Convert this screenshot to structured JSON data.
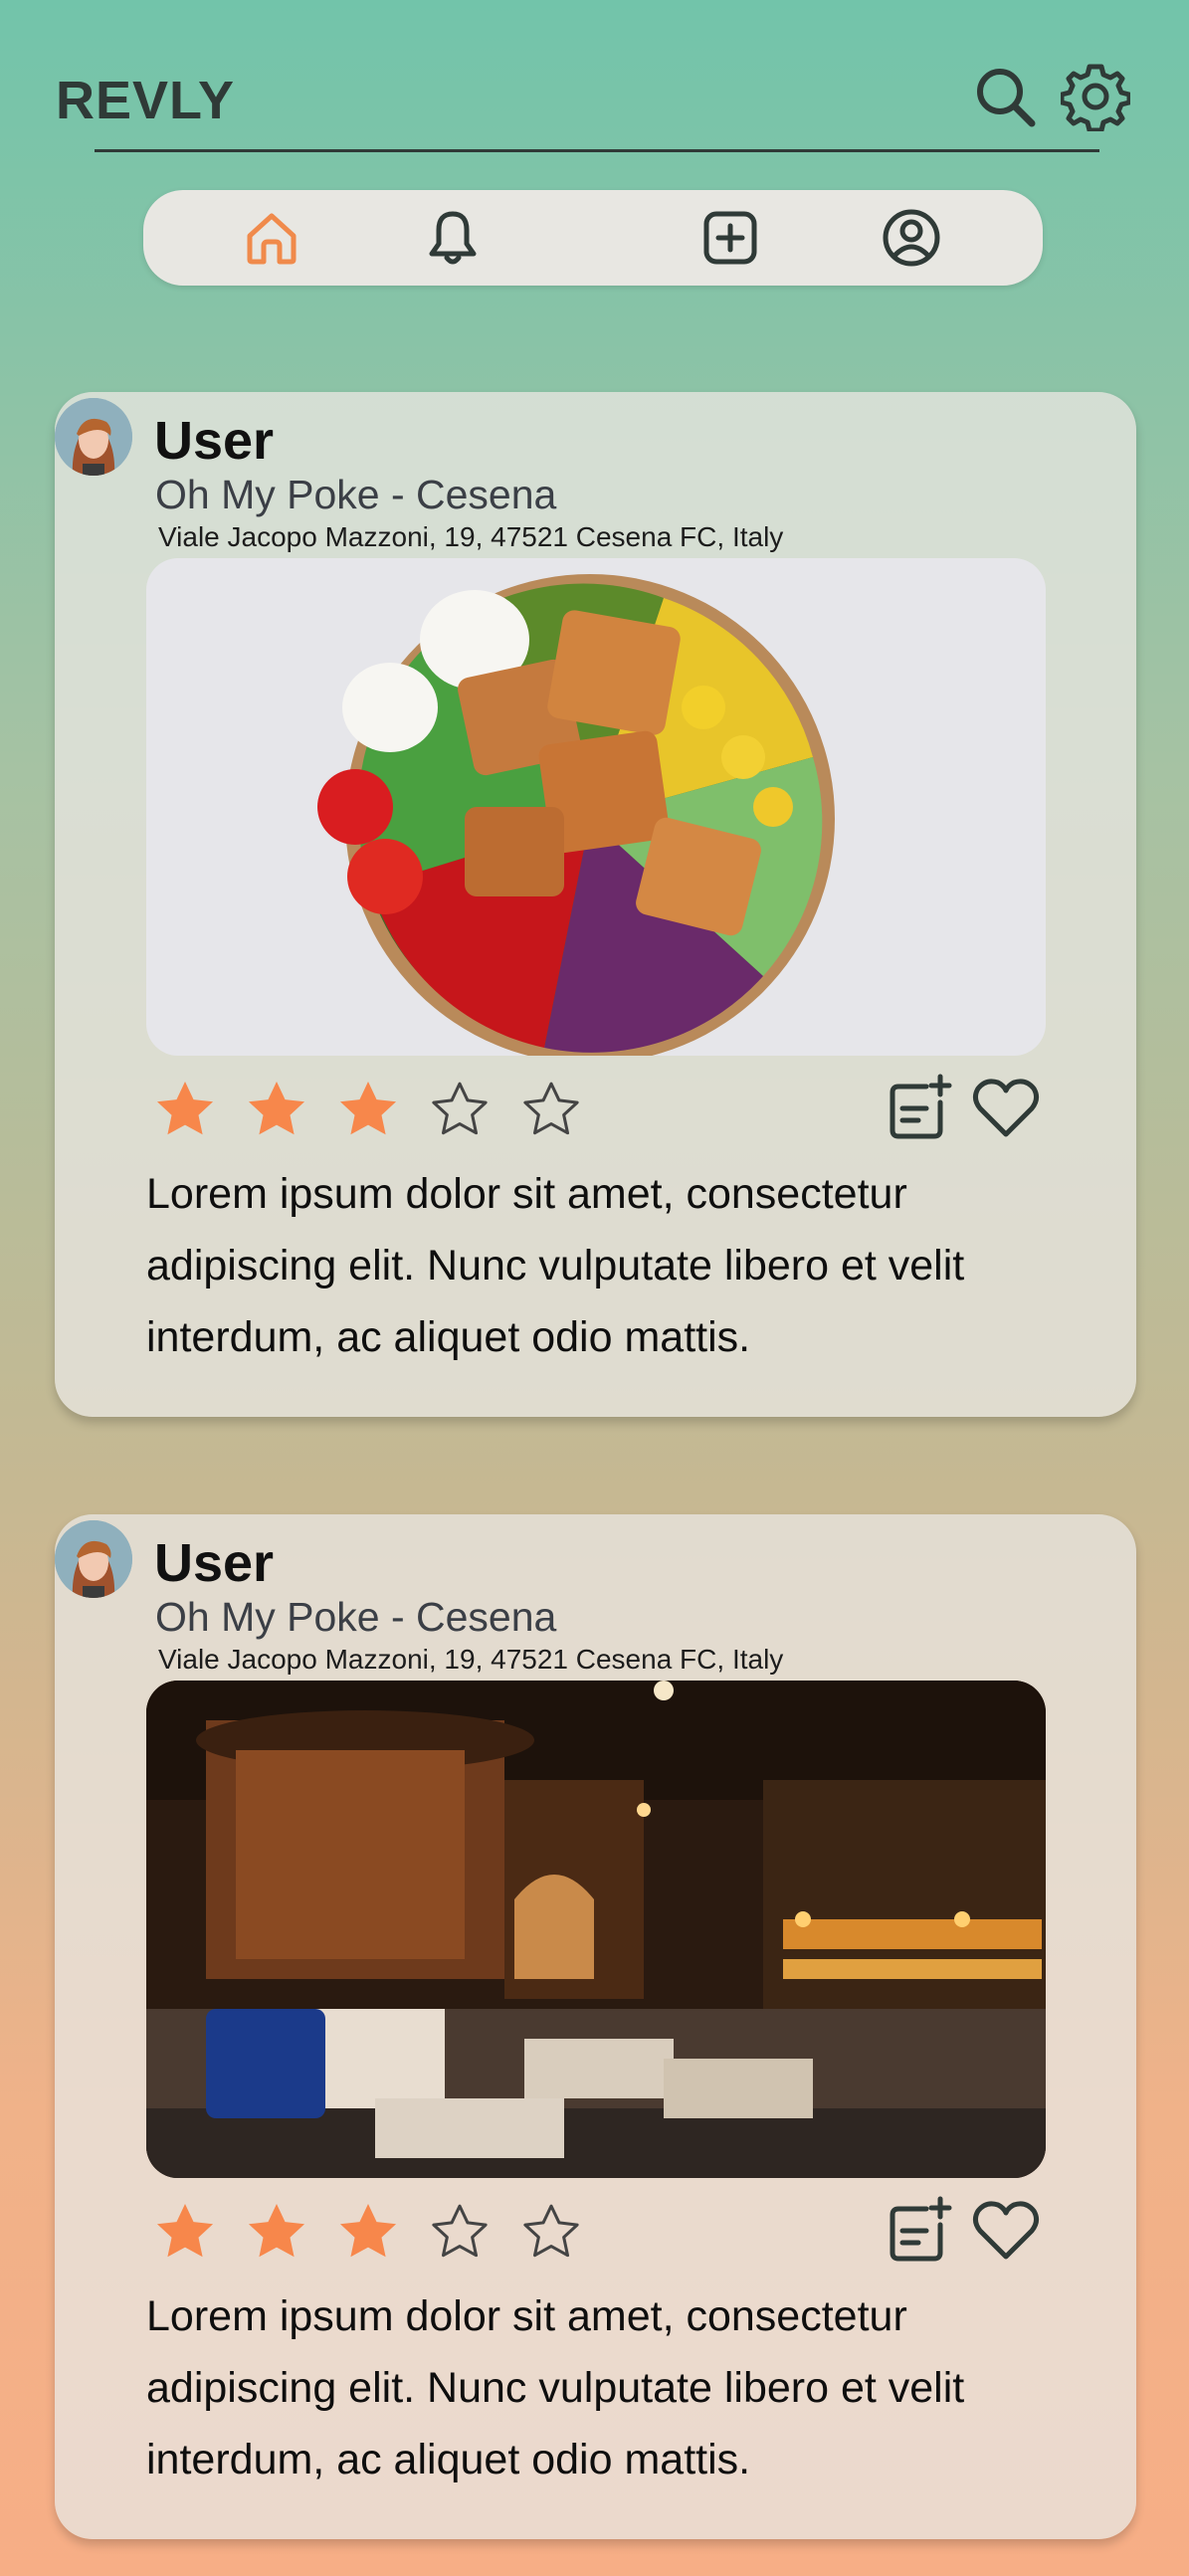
{
  "app": {
    "title": "REVLY"
  },
  "header": {
    "icons": [
      "search-icon",
      "gear-icon"
    ]
  },
  "navbar": {
    "items": [
      "home-icon",
      "bell-icon",
      "add-post-icon",
      "profile-icon"
    ],
    "active": "home-icon",
    "accent": "#f08a4b"
  },
  "colors": {
    "star_filled": "#f7874b",
    "text_dark": "#2f3a37"
  },
  "posts": [
    {
      "user": "User",
      "place": "Oh My Poke - Cesena",
      "address": "Viale Jacopo Mazzoni, 19, 47521 Cesena FC, Italy",
      "image": "poke-bowl-photo",
      "rating": 3,
      "max_rating": 5,
      "text": "Lorem ipsum dolor sit amet, consectetur adipiscing elit. Nunc vulputate libero et velit interdum, ac aliquet odio mattis."
    },
    {
      "user": "User",
      "place": "Oh My Poke - Cesena",
      "address": "Viale Jacopo Mazzoni, 19, 47521 Cesena FC, Italy",
      "image": "restaurant-interior-photo",
      "rating": 3,
      "max_rating": 5,
      "text": "Lorem ipsum dolor sit amet, consectetur adipiscing elit. Nunc vulputate libero et velit interdum, ac aliquet odio mattis."
    }
  ]
}
